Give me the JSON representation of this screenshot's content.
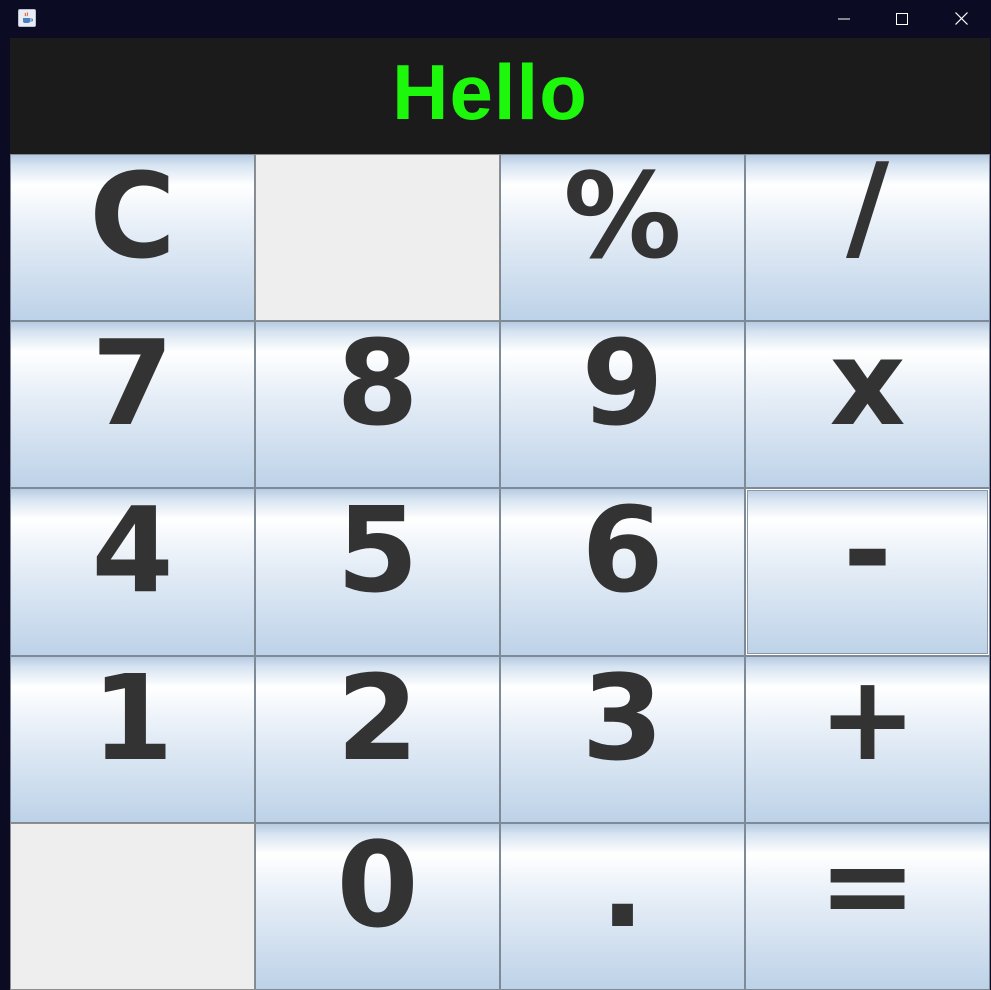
{
  "titlebar": {
    "app_icon": "java-cup-icon",
    "controls": [
      "minimize-icon",
      "maximize-icon",
      "close-icon"
    ]
  },
  "display": {
    "text": "Hello",
    "color": "#1cf70b",
    "background": "#1b1b1b"
  },
  "keypad": {
    "rows": [
      [
        "C",
        "",
        "%",
        "/"
      ],
      [
        "7",
        "8",
        "9",
        "x"
      ],
      [
        "4",
        "5",
        "6",
        "-"
      ],
      [
        "1",
        "2",
        "3",
        "+"
      ],
      [
        "",
        "0",
        ".",
        "="
      ]
    ]
  }
}
